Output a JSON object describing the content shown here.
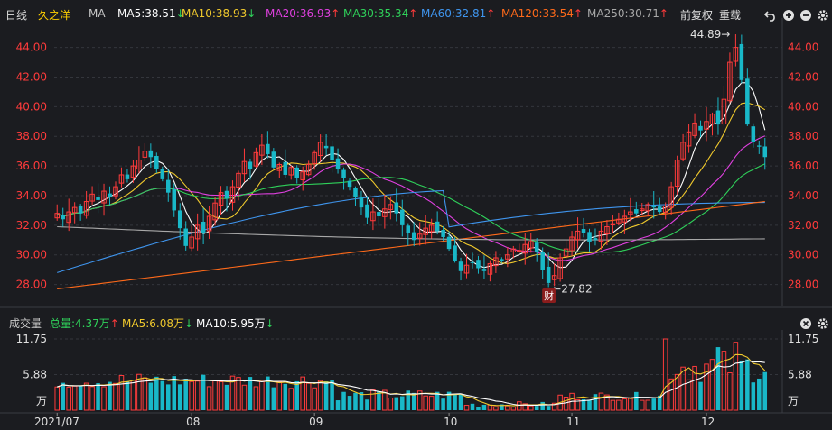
{
  "header": {
    "period": "日线",
    "stock_name": "久之洋",
    "indicator": "MA",
    "ma": [
      {
        "label": "MA5:38.51",
        "arrow": "↓",
        "color": "#ffffff"
      },
      {
        "label": "MA10:38.93",
        "arrow": "↓",
        "color": "#f0c92d"
      },
      {
        "label": "MA20:36.93",
        "arrow": "↑",
        "color": "#e040e0"
      },
      {
        "label": "MA30:35.34",
        "arrow": "↑",
        "color": "#2fd15a"
      },
      {
        "label": "MA60:32.81",
        "arrow": "↑",
        "color": "#3f95ee"
      },
      {
        "label": "MA120:33.54",
        "arrow": "↑",
        "color": "#ff6a1a"
      },
      {
        "label": "MA250:30.71",
        "arrow": "↑",
        "color": "#a8a8a8"
      }
    ],
    "adjust": "前复权",
    "overlay": "重载",
    "up_arrow_color": "#ff3b3b",
    "down_arrow_color": "#2fd15a"
  },
  "price_axis": [
    "44.00",
    "42.00",
    "40.00",
    "38.00",
    "36.00",
    "34.00",
    "32.00",
    "30.00",
    "28.00"
  ],
  "annotations": {
    "high": "44.89→",
    "low": "←27.82",
    "event_badge": "财"
  },
  "volume_header": {
    "title": "成交量",
    "total": "总量:4.37万",
    "total_arrow": "↑",
    "ma5": "MA5:6.08万",
    "ma5_arrow": "↓",
    "ma10": "MA10:5.95万",
    "ma10_arrow": "↓"
  },
  "volume_axis": {
    "top": "11.75",
    "mid": "5.88",
    "unit": "万"
  },
  "time_axis": [
    "2021/07",
    "08",
    "09",
    "10",
    "11",
    "12"
  ],
  "chart_data": {
    "type": "candlestick",
    "price_range": [
      27.0,
      45.5
    ],
    "volume_range_wan": [
      0,
      11.75
    ],
    "up_color": "#ff3b3b",
    "down_color": "#19b8c8",
    "months": [
      "2021/07",
      "08",
      "09",
      "10",
      "11",
      "12"
    ],
    "close": [
      32.8,
      32.4,
      32.9,
      33.2,
      32.8,
      33.6,
      34.1,
      33.7,
      34.3,
      33.9,
      34.6,
      35.4,
      35.1,
      36.0,
      36.4,
      37.0,
      36.6,
      35.8,
      35.1,
      34.2,
      33.0,
      31.8,
      30.6,
      31.2,
      32.0,
      31.5,
      32.6,
      33.5,
      34.2,
      33.8,
      34.6,
      35.5,
      36.3,
      35.8,
      36.9,
      37.4,
      36.8,
      35.9,
      36.1,
      35.4,
      35.9,
      35.2,
      35.6,
      36.1,
      36.9,
      37.6,
      37.2,
      36.4,
      35.8,
      35.2,
      34.6,
      33.9,
      33.2,
      32.5,
      32.9,
      32.6,
      33.1,
      33.4,
      32.8,
      32.0,
      31.5,
      31.0,
      31.4,
      31.8,
      32.0,
      31.6,
      31.2,
      30.4,
      29.6,
      28.9,
      29.3,
      29.5,
      29.1,
      28.9,
      29.4,
      29.8,
      29.6,
      30.0,
      30.4,
      30.3,
      30.7,
      30.9,
      30.2,
      29.0,
      28.1,
      28.6,
      29.8,
      30.4,
      31.2,
      31.6,
      31.5,
      30.9,
      31.0,
      31.6,
      31.9,
      32.1,
      32.4,
      32.6,
      32.9,
      32.8,
      33.1,
      33.4,
      33.2,
      32.9,
      33.3,
      34.6,
      36.4,
      37.6,
      38.3,
      38.9,
      38.4,
      39.0,
      39.5,
      38.8,
      40.5,
      43.0,
      44.0,
      41.8,
      38.8,
      37.6,
      37.3,
      36.6
    ]
  }
}
